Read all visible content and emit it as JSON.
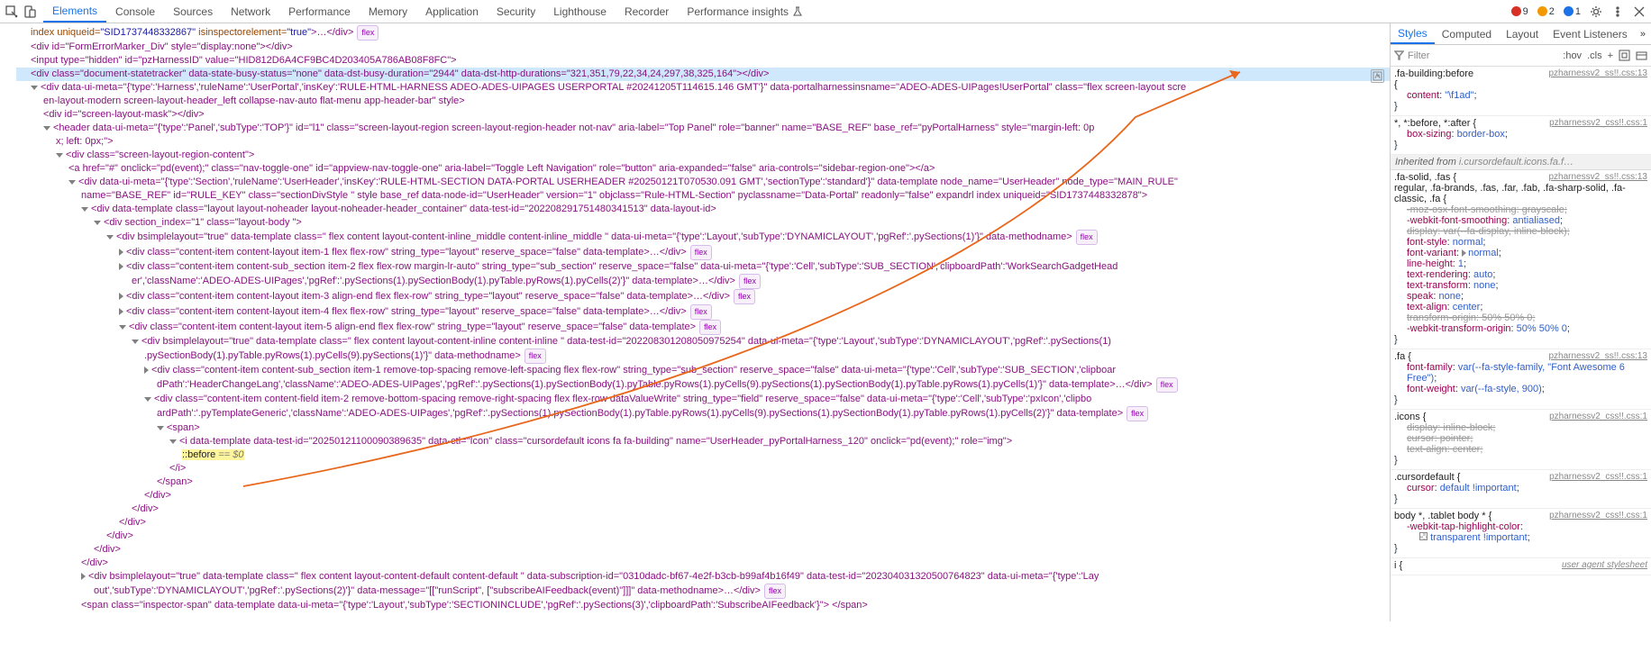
{
  "top": {
    "tabs": [
      "Elements",
      "Console",
      "Sources",
      "Network",
      "Performance",
      "Memory",
      "Application",
      "Security",
      "Lighthouse",
      "Recorder",
      "Performance insights"
    ],
    "active_tab": 0,
    "lab_icon": "flask-icon",
    "errors": 9,
    "warnings": 2,
    "info": 1
  },
  "dom": {
    "l0a": "index uniqueid=",
    "l0b": "\"SID1737448332867\"",
    "l0c": " isinspectorelement=",
    "l0d": "\"true\"",
    "l0e": ">…</div>",
    "l1": "<div id=\"FormErrorMarker_Div\" style=\"display:none\"></div>",
    "l2": "<input type=\"hidden\" id=\"pzHarnessID\" value=\"HID812D6A4CF9BC4D203405A786AB08F8FC\">",
    "l3": "<div class=\"document-statetracker\" data-state-busy-status=\"none\" data-dst-busy-duration=\"2944\" data-dst-http-durations=\"321,351,79,22,34,24,297,38,325,164\"></div>",
    "l4a": "<div data-ui-meta=\"{'type':'Harness','ruleName':'UserPortal','insKey':'RULE-HTML-HARNESS ADEO-ADES-UIPAGES USERPORTAL #20241205T114615.146 GMT'}\" data-portalharnessinsname=\"ADEO-ADES-UIPages!UserPortal\" class=\"flex screen-layout scre",
    "l4b": "en-layout-modern screen-layout-header_left collapse-nav-auto flat-menu app-header-bar\" style>",
    "l5": "<div id=\"screen-layout-mask\"></div>",
    "l6a": "<header data-ui-meta=\"{'type':'Panel','subType':'TOP'}\" id=\"l1\" class=\"screen-layout-region screen-layout-region-header not-nav\" aria-label=\"Top Panel\" role=\"banner\" name=\"BASE_REF\" base_ref=\"pyPortalHarness\" style=\"margin-left: 0p",
    "l6b": "x; left: 0px;\">",
    "l7": "<div class=\"screen-layout-region-content\">",
    "l8": "<a href=\"#\" onclick=\"pd(event);\" class=\"nav-toggle-one\" id=\"appview-nav-toggle-one\" aria-label=\"Toggle Left Navigation\" role=\"button\" aria-expanded=\"false\" aria-controls=\"sidebar-region-one\"></a>",
    "l9a": "<div data-ui-meta=\"{'type':'Section','ruleName':'UserHeader','insKey':'RULE-HTML-SECTION DATA-PORTAL USERHEADER #20250121T070530.091 GMT','sectionType':'standard'}\" data-template node_name=\"UserHeader\" node_type=\"MAIN_RULE\"",
    "l9b": "name=\"BASE_REF\" id=\"RULE_KEY\" class=\"sectionDivStyle \" style base_ref data-node-id=\"UserHeader\" version=\"1\" objclass=\"Rule-HTML-Section\" pyclassname=\"Data-Portal\" readonly=\"false\" expandrl index uniqueid=\"SID1737448332878\">",
    "l10": "<div data-template class=\"layout layout-noheader layout-noheader-header_container\" data-test-id=\"202208291751480341513\" data-layout-id>",
    "l11": "<div section_index=\"1\" class=\"layout-body  \">",
    "l12": "<div bsimplelayout=\"true\" data-template class=\" flex content layout-content-inline_middle  content-inline_middle \" data-ui-meta=\"{'type':'Layout','subType':'DYNAMICLAYOUT','pgRef':'.pySections(1)'}\" data-methodname>",
    "l13": "<div class=\"content-item content-layout item-1 flex flex-row\" string_type=\"layout\" reserve_space=\"false\" data-template>…</div>",
    "l14a": "<div class=\"content-item content-sub_section item-2 flex flex-row margin-lr-auto\" string_type=\"sub_section\" reserve_space=\"false\" data-ui-meta=\"{'type':'Cell','subType':'SUB_SECTION','clipboardPath':'WorkSearchGadgetHead",
    "l14b": "er','className':'ADEO-ADES-UIPages','pgRef':'.pySections(1).pySectionBody(1).pyTable.pyRows(1).pyCells(2)'}\" data-template>…</div>",
    "l15": "<div class=\"content-item content-layout item-3 align-end flex flex-row\" string_type=\"layout\" reserve_space=\"false\" data-template>…</div>",
    "l16": "<div class=\"content-item content-layout item-4 flex flex-row\" string_type=\"layout\" reserve_space=\"false\" data-template>…</div>",
    "l17": "<div class=\"content-item content-layout item-5 align-end flex flex-row\" string_type=\"layout\" reserve_space=\"false\" data-template>",
    "l18a": "<div bsimplelayout=\"true\" data-template class=\" flex content layout-content-inline  content-inline \" data-test-id=\"202208301208050975254\" data-ui-meta=\"{'type':'Layout','subType':'DYNAMICLAYOUT','pgRef':'.pySections(1)",
    "l18b": ".pySectionBody(1).pyTable.pyRows(1).pyCells(9).pySections(1)'}\" data-methodname>",
    "l19a": "<div class=\"content-item content-sub_section item-1 remove-top-spacing remove-left-spacing flex flex-row\" string_type=\"sub_section\" reserve_space=\"false\" data-ui-meta=\"{'type':'Cell','subType':'SUB_SECTION','clipboar",
    "l19b": "dPath':'HeaderChangeLang','className':'ADEO-ADES-UIPages','pgRef':'.pySections(1).pySectionBody(1).pyTable.pyRows(1).pyCells(9).pySections(1).pySectionBody(1).pyTable.pyRows(1).pyCells(1)'}\" data-template>…</div>",
    "l20a": "<div class=\"content-item content-field item-2 remove-bottom-spacing remove-right-spacing flex flex-row dataValueWrite\" string_type=\"field\" reserve_space=\"false\" data-ui-meta=\"{'type':'Cell','subType':'pxIcon','clipbo",
    "l20b": "ardPath':'.pyTemplateGeneric','className':'ADEO-ADES-UIPages','pgRef':'.pySections(1).pySectionBody(1).pyTable.pyRows(1).pyCells(9).pySections(1).pySectionBody(1).pyTable.pyRows(1).pyCells(2)'}\" data-template>",
    "l21": "<span>",
    "l22": "<i data-template data-test-id=\"20250121100090389635\" data-ctl=\"Icon\" class=\"cursordefault icons fa fa-building\" name=\"UserHeader_pyPortalHarness_120\" onclick=\"pd(event);\" role=\"img\">",
    "l23": "::before",
    "l23b": " == $0",
    "l24": "</i>",
    "l25": "</span>",
    "l26": "</div>",
    "l27": "</div>",
    "l28": "</div>",
    "l29": "</div>",
    "l30": "</div>",
    "l31": "</div>",
    "l32a": "<div bsimplelayout=\"true\" data-template class=\" flex content layout-content-default  content-default \" data-subscription-id=\"0310dadc-bf67-4e2f-b3cb-b99af4b16f49\" data-test-id=\"202304031320500764823\" data-ui-meta=\"{'type':'Lay",
    "l32b": "out','subType':'DYNAMICLAYOUT','pgRef':'.pySections(2)'}\" data-message=\"[[\"runScript\", [\"subscribeAIFeedback(event)\"]]]\" data-methodname>…</div>",
    "l33": "<span class=\"inspector-span\" data-template data-ui-meta=\"{'type':'Layout','subType':'SECTIONINCLUDE','pgRef':'.pySections(3)','clipboardPath':'SubscribeAIFeedback'}\"> </span>",
    "flex_badge": "flex"
  },
  "styles": {
    "tabs": [
      "Styles",
      "Computed",
      "Layout",
      "Event Listeners"
    ],
    "filter_ph": "Filter",
    "tools": [
      ":hov",
      ".cls",
      "+"
    ],
    "rule1_sel": ".fa-building:before",
    "rule1_src": "pzharnessv2_ss!!.css:13",
    "rule1_p1n": "content",
    "rule1_p1v": "\"\\f1ad\"",
    "rule2_sel": "*, *:before, *:after {",
    "rule2_src": "pzharnessv2_css!!.css:1",
    "rule2_p1n": "box-sizing",
    "rule2_p1v": "border-box",
    "inh_label": "Inherited from ",
    "inh_link": "i.cursordefault.icons.fa.f…",
    "rule3_sel1": ".fa-solid, .fas {",
    "rule3_src": "pzharnessv2_ss!!.css:13",
    "rule3_sel2": "regular, .fa-brands, .fas, .far, .fab, .fa-sharp-solid, .fa-classic, .fa {",
    "rule3_p1n": "-moz-osx-font-smoothing",
    "rule3_p1v": "grayscale",
    "rule3_p2n": "-webkit-font-smoothing",
    "rule3_p2v": "antialiased",
    "rule3_p3n": "display",
    "rule3_p3v": "var(--fa-display, inline-block)",
    "rule3_p4n": "font-style",
    "rule3_p4v": "normal",
    "rule3_p5n": "font-variant",
    "rule3_p5v": "normal",
    "rule3_p6n": "line-height",
    "rule3_p6v": "1",
    "rule3_p7n": "text-rendering",
    "rule3_p7v": "auto",
    "rule3_p8n": "text-transform",
    "rule3_p8v": "none",
    "rule3_p9n": "speak",
    "rule3_p9v": "none",
    "rule3_p10n": "text-align",
    "rule3_p10v": "center",
    "rule3_p11n": "transform-origin",
    "rule3_p11v": "50% 50% 0",
    "rule3_p12n": "-webkit-transform-origin",
    "rule3_p12v": "50% 50% 0",
    "rule4_sel": ".fa {",
    "rule4_src": "pzharnessv2_ss!!.css:13",
    "rule4_p1n": "font-family",
    "rule4_p1v": "var(--fa-style-family, \"Font Awesome 6 Free\")",
    "rule4_p2n": "font-weight",
    "rule4_p2v": "var(--fa-style, 900)",
    "rule5_sel": ".icons {",
    "rule5_src": "pzharnessv2_css!!.css:1",
    "rule5_p1n": "display",
    "rule5_p1v": "inline-block",
    "rule5_p2n": "cursor",
    "rule5_p2v": "pointer",
    "rule5_p3n": "text-align",
    "rule5_p3v": "center",
    "rule6_sel": ".cursordefault {",
    "rule6_src": "pzharnessv2_css!!.css:1",
    "rule6_p1n": "cursor",
    "rule6_p1v": "default !important",
    "rule7_sel": "body *, .tablet body * {",
    "rule7_src": "pzharnessv2_css!!.css:1",
    "rule7_p1n": "-webkit-tap-highlight-color",
    "rule7_p2": "transparent !important",
    "rule8_sel": "i {",
    "rule8_src": "user agent stylesheet"
  }
}
